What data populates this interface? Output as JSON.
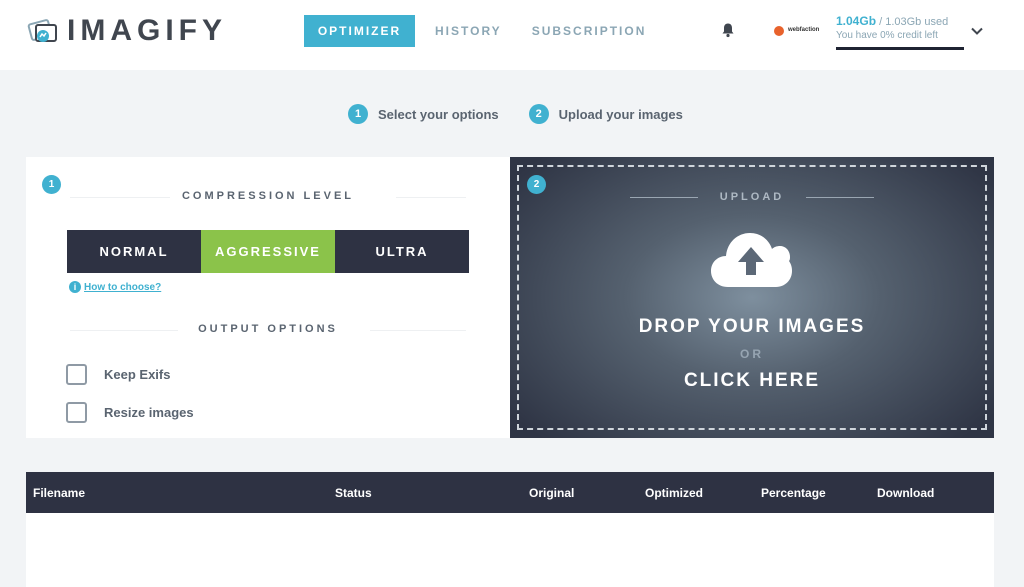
{
  "app": {
    "logo_text": "IMAGIFY"
  },
  "nav": {
    "items": [
      {
        "label": "OPTIMIZER",
        "active": true
      },
      {
        "label": "HISTORY",
        "active": false
      },
      {
        "label": "SUBSCRIPTION",
        "active": false
      }
    ]
  },
  "account": {
    "brand": "webfaction",
    "used": "1.04Gb",
    "total": " / 1.03Gb used",
    "credit": "You have 0% credit left",
    "credit_percent": 0
  },
  "steps": [
    {
      "num": "1",
      "label": "Select your options"
    },
    {
      "num": "2",
      "label": "Upload your images"
    }
  ],
  "options": {
    "badge": "1",
    "compression_title": "COMPRESSION LEVEL",
    "levels": [
      {
        "label": "NORMAL",
        "selected": false
      },
      {
        "label": "AGGRESSIVE",
        "selected": true
      },
      {
        "label": "ULTRA",
        "selected": false
      }
    ],
    "howto_icon": "i",
    "howto_label": "How to choose?",
    "output_title": "OUTPUT OPTIONS",
    "checkboxes": [
      {
        "label": "Keep Exifs",
        "checked": false
      },
      {
        "label": "Resize images",
        "checked": false
      }
    ]
  },
  "upload": {
    "badge": "2",
    "title": "UPLOAD",
    "drop_text": "DROP YOUR IMAGES",
    "or_text": "OR",
    "click_text": "CLICK HERE"
  },
  "table": {
    "columns": [
      "Filename",
      "Status",
      "Original",
      "Optimized",
      "Percentage",
      "Download"
    ],
    "rows": []
  },
  "colors": {
    "accent": "#40b1d0",
    "selected_level": "#8bc34a",
    "dark": "#2e3243",
    "background": "#f2f4f6"
  },
  "icons": [
    "logo-icon",
    "bell-icon",
    "chevron-down-icon",
    "info-icon",
    "cloud-upload-icon"
  ]
}
